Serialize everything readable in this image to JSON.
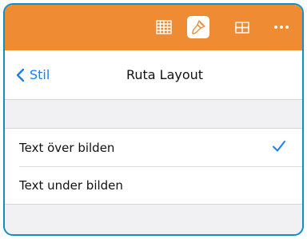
{
  "toolbar": {
    "buttons": [
      {
        "icon": "table-grid-icon",
        "active": false
      },
      {
        "icon": "paintbrush-icon",
        "active": true
      },
      {
        "icon": "cell-grid-icon",
        "active": false
      },
      {
        "icon": "more-icon",
        "active": false
      }
    ],
    "colors": {
      "background": "#ef8b33",
      "active_bg": "#ffffff"
    }
  },
  "navbar": {
    "back_label": "Stil",
    "title": "Ruta Layout"
  },
  "options": [
    {
      "label": "Text över bilden",
      "selected": true
    },
    {
      "label": "Text under bilden",
      "selected": false
    }
  ],
  "accent": "#1b7ff5"
}
